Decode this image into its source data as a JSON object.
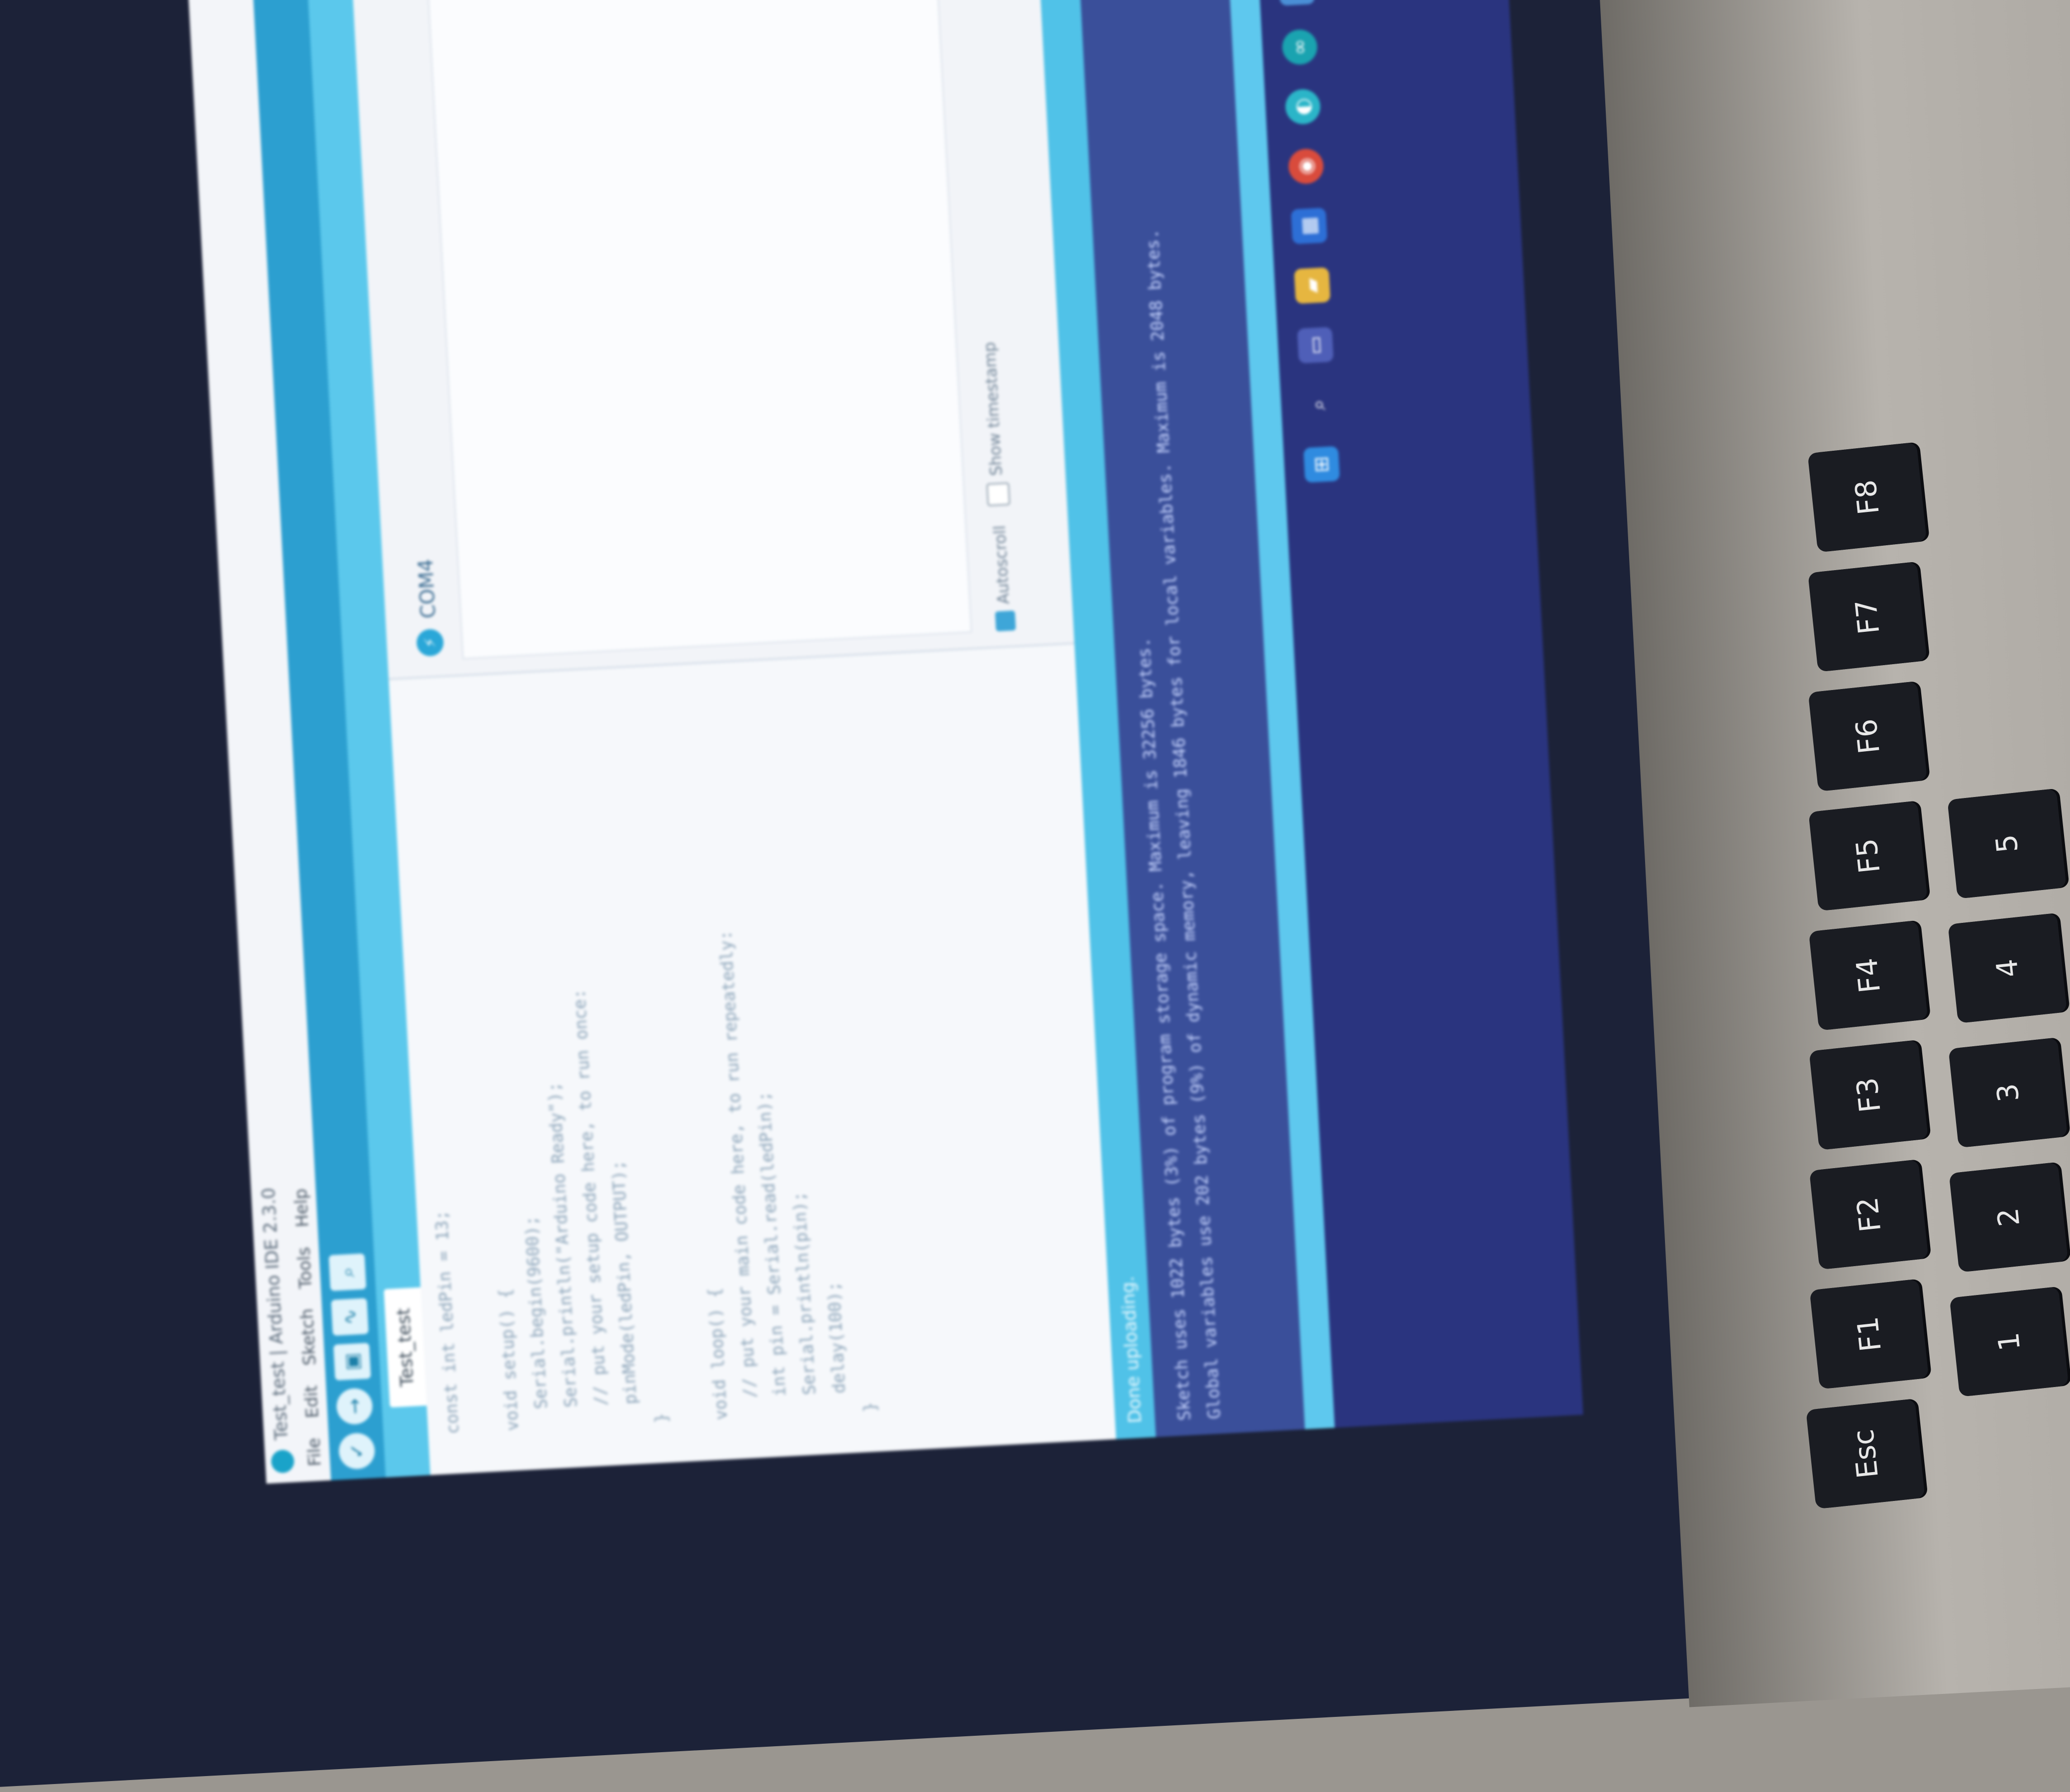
{
  "window": {
    "title": "Test_test | Arduino IDE 2.3.0"
  },
  "menu": [
    "File",
    "Edit",
    "Sketch",
    "Tools",
    "Help"
  ],
  "toolbar": {
    "verify_icon": "check-icon",
    "upload_icon": "arrow-right-icon",
    "debug_icon": "debug-icon",
    "plotter_icon": "plotter-icon",
    "monitor_icon": "serial-monitor-icon"
  },
  "tab": {
    "label": "Test_test"
  },
  "editor": {
    "lines": [
      "const int ledPin = 13;",
      "",
      "void setup() {",
      "  Serial.begin(9600);",
      "  Serial.println(\"Arduino Ready\");",
      "  // put your setup code here, to run once:",
      "  pinMode(ledPin, OUTPUT);",
      "}",
      "",
      "void loop() {",
      "  // put your main code here, to run repeatedly:",
      "  int pin = Serial.read(ledPin);",
      "  Serial.println(pin);",
      "  delay(100);",
      "}"
    ]
  },
  "serial_monitor": {
    "port": "COM4",
    "autoscroll_label": "Autoscroll",
    "timestamp_label": "Show timestamp"
  },
  "output": {
    "header": "Done uploading.",
    "lines": [
      "Sketch uses 1022 bytes (3%) of program storage space. Maximum is 32256 bytes.",
      "Global variables use 202 bytes (9%) of dynamic memory, leaving 1846 bytes for local variables. Maximum is 2048 bytes."
    ]
  },
  "taskbar": {
    "icons": [
      "windows-start-icon",
      "search-icon",
      "task-view-icon",
      "file-explorer-icon",
      "store-icon",
      "chrome-icon",
      "edge-icon",
      "arduino-icon",
      "app-icon"
    ]
  },
  "keyboard": {
    "keys": [
      "Esc",
      "F1",
      "F2",
      "F3",
      "F4",
      "F5",
      "F6",
      "F7",
      "F8",
      "1",
      "2",
      "3",
      "4",
      "5"
    ]
  },
  "colors": {
    "toolbar": "#2c9fd0",
    "tab_strip": "#5bc8ec",
    "console": "#3a4f9a",
    "taskbar": "#2a347f"
  }
}
